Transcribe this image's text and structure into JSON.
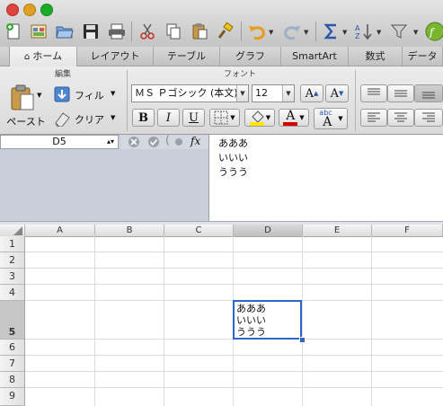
{
  "toolbar": {
    "traffic_colors": [
      "#e0443e",
      "#dea123",
      "#1aab29"
    ]
  },
  "ribbon_tabs": [
    {
      "label": "ホーム",
      "active": true
    },
    {
      "label": "レイアウト"
    },
    {
      "label": "テーブル"
    },
    {
      "label": "グラフ"
    },
    {
      "label": "SmartArt"
    },
    {
      "label": "数式"
    },
    {
      "label": "データ"
    }
  ],
  "groups": {
    "edit_label": "編集",
    "font_label": "フォント"
  },
  "edit": {
    "paste_label": "ペースト",
    "fill_label": "フィル",
    "clear_label": "クリア"
  },
  "font": {
    "name": "ＭＳ Ｐゴシック (本文)",
    "size": "12",
    "grow_label": "A",
    "shrink_label": "A",
    "bold_label": "B",
    "italic_label": "I",
    "underline_label": "U",
    "font_color_label": "A",
    "phonetic_top": "abc",
    "phonetic_bottom": "A",
    "highlight_color": "#ffe600",
    "font_color": "#d40000"
  },
  "formula_bar": {
    "name_box": "D5",
    "fx_label": "fx",
    "lines": [
      "あああ",
      "いいい",
      "ううう"
    ]
  },
  "sheet": {
    "columns": [
      "A",
      "B",
      "C",
      "D",
      "E",
      "F"
    ],
    "rows": [
      "1",
      "2",
      "3",
      "4",
      "5",
      "6",
      "7",
      "8",
      "9"
    ],
    "selected_column": "D",
    "selected_row": "5",
    "active_cell": "D5",
    "active_cell_lines": [
      "あああ",
      "いいい",
      "ううう"
    ]
  }
}
